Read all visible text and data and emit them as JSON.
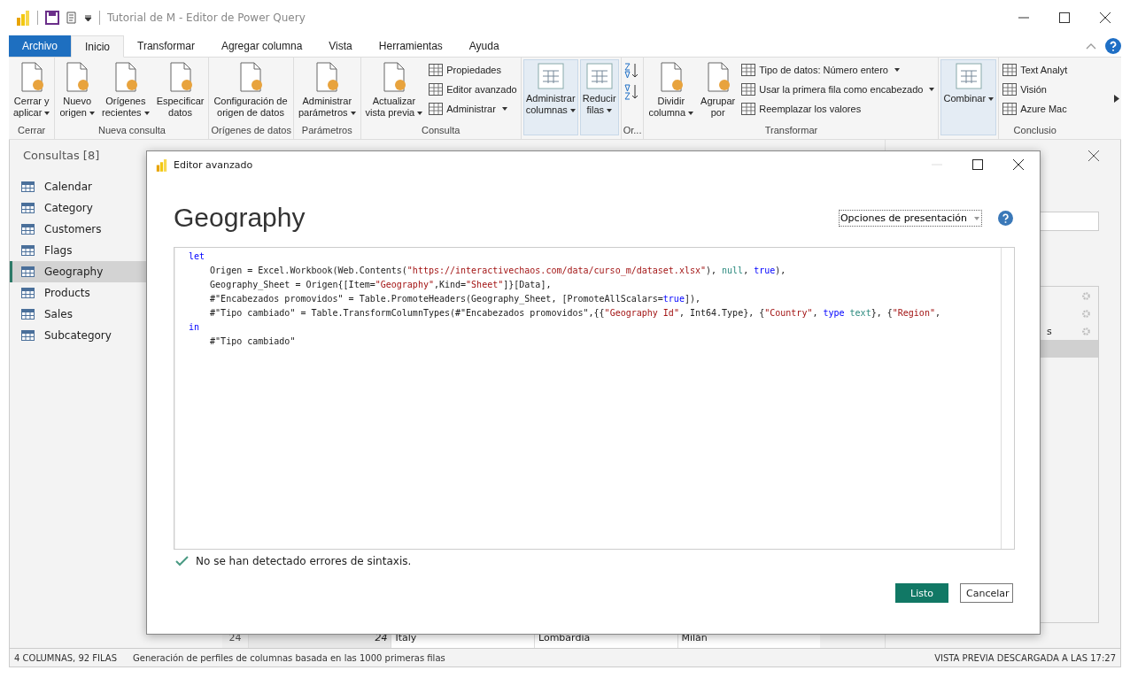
{
  "window": {
    "title": "Tutorial de M - Editor de Power Query"
  },
  "tabs": [
    {
      "label": "Archivo",
      "kind": "file",
      "selected": false
    },
    {
      "label": "Inicio",
      "kind": "tab",
      "selected": true
    },
    {
      "label": "Transformar",
      "kind": "tab",
      "selected": false
    },
    {
      "label": "Agregar columna",
      "kind": "tab",
      "selected": false
    },
    {
      "label": "Vista",
      "kind": "tab",
      "selected": false
    },
    {
      "label": "Herramientas",
      "kind": "tab",
      "selected": false
    },
    {
      "label": "Ayuda",
      "kind": "tab",
      "selected": false
    }
  ],
  "ribbon": [
    {
      "label": "Cerrar",
      "items": [
        {
          "kind": "large",
          "label": "Cerrar y\naplicar",
          "dropdown": true
        }
      ]
    },
    {
      "label": "Nueva consulta",
      "items": [
        {
          "kind": "large",
          "label": "Nuevo\norigen",
          "dropdown": true
        },
        {
          "kind": "large",
          "label": "Orígenes\nrecientes",
          "dropdown": true
        },
        {
          "kind": "large",
          "label": "Especificar\ndatos",
          "dropdown": false
        }
      ]
    },
    {
      "label": "Orígenes de datos",
      "items": [
        {
          "kind": "large",
          "label": "Configuración de\norigen de datos",
          "dropdown": false
        }
      ]
    },
    {
      "label": "Parámetros",
      "items": [
        {
          "kind": "large",
          "label": "Administrar\nparámetros",
          "dropdown": true
        }
      ]
    },
    {
      "label": "Consulta",
      "items": [
        {
          "kind": "large",
          "label": "Actualizar\nvista previa",
          "dropdown": true
        },
        {
          "kind": "stack",
          "entries": [
            {
              "label": "Propiedades",
              "dropdown": false
            },
            {
              "label": "Editor avanzado",
              "dropdown": false
            },
            {
              "label": "Administrar",
              "dropdown": true
            }
          ]
        }
      ]
    },
    {
      "items": [
        {
          "kind": "collapsed",
          "label": "Administrar\ncolumnas",
          "dropdown": true
        },
        {
          "kind": "collapsed",
          "label": "Reducir\nfilas",
          "dropdown": true
        }
      ]
    },
    {
      "label": "Or...",
      "items": [
        {
          "kind": "sort"
        }
      ]
    },
    {
      "label": "Transformar",
      "items": [
        {
          "kind": "large",
          "label": "Dividir\ncolumna",
          "dropdown": true
        },
        {
          "kind": "large",
          "label": "Agrupar\npor",
          "dropdown": false
        },
        {
          "kind": "stack",
          "entries": [
            {
              "label": "Tipo de datos: Número entero",
              "dropdown": true
            },
            {
              "label": "Usar la primera fila como encabezado",
              "dropdown": true
            },
            {
              "label": "Reemplazar los valores",
              "dropdown": false
            }
          ]
        }
      ]
    },
    {
      "items": [
        {
          "kind": "collapsed",
          "label": "Combinar",
          "dropdown": true
        }
      ]
    },
    {
      "label": "Conclusio",
      "items": [
        {
          "kind": "stack",
          "entries": [
            {
              "label": "Text Analyt",
              "dropdown": false
            },
            {
              "label": "Visión",
              "dropdown": false
            },
            {
              "label": "Azure Mac",
              "dropdown": false
            }
          ]
        }
      ]
    }
  ],
  "queries": {
    "title": "Consultas [8]",
    "items": [
      {
        "label": "Calendar",
        "selected": false
      },
      {
        "label": "Category",
        "selected": false
      },
      {
        "label": "Customers",
        "selected": false
      },
      {
        "label": "Flags",
        "selected": false
      },
      {
        "label": "Geography",
        "selected": true
      },
      {
        "label": "Products",
        "selected": false
      },
      {
        "label": "Sales",
        "selected": false
      },
      {
        "label": "Subcategory",
        "selected": false
      }
    ]
  },
  "table_row": {
    "row_number": "24",
    "cells": [
      "24",
      "Italy",
      "Lombardía",
      "Milán"
    ]
  },
  "steps": [
    {
      "selected": false
    },
    {
      "selected": false
    },
    {
      "label": "s",
      "selected": false
    },
    {
      "selected": true
    }
  ],
  "dialog": {
    "title": "Editor avanzado",
    "heading": "Geography",
    "options": "Opciones de presentación",
    "code": [
      [
        {
          "text": "let",
          "kind": "keyword"
        }
      ],
      [
        {
          "text": "    Origen = Excel.Workbook(Web.Contents(",
          "kind": "plain"
        },
        {
          "text": "\"https://interactivechaos.com/data/curso_m/dataset.xlsx\"",
          "kind": "string"
        },
        {
          "text": "), ",
          "kind": "plain"
        },
        {
          "text": "null",
          "kind": "literal"
        },
        {
          "text": ", ",
          "kind": "plain"
        },
        {
          "text": "true",
          "kind": "keyword"
        },
        {
          "text": "),",
          "kind": "plain"
        }
      ],
      [
        {
          "text": "    Geography_Sheet = Origen{[Item=",
          "kind": "plain"
        },
        {
          "text": "\"Geography\"",
          "kind": "string"
        },
        {
          "text": ",Kind=",
          "kind": "plain"
        },
        {
          "text": "\"Sheet\"",
          "kind": "string"
        },
        {
          "text": "]}[Data],",
          "kind": "plain"
        }
      ],
      [
        {
          "text": "    #\"Encabezados promovidos\" = Table.PromoteHeaders(Geography_Sheet, [PromoteAllScalars=",
          "kind": "plain"
        },
        {
          "text": "true",
          "kind": "keyword"
        },
        {
          "text": "]),",
          "kind": "plain"
        }
      ],
      [
        {
          "text": "    #\"Tipo cambiado\" = Table.TransformColumnTypes(#\"Encabezados promovidos\",{{",
          "kind": "plain"
        },
        {
          "text": "\"Geography Id\"",
          "kind": "string"
        },
        {
          "text": ", Int64.Type}, {",
          "kind": "plain"
        },
        {
          "text": "\"Country\"",
          "kind": "string"
        },
        {
          "text": ", ",
          "kind": "plain"
        },
        {
          "text": "type",
          "kind": "keyword"
        },
        {
          "text": " text",
          "kind": "literal"
        },
        {
          "text": "}, {",
          "kind": "plain"
        },
        {
          "text": "\"Region\"",
          "kind": "string"
        },
        {
          "text": ",",
          "kind": "plain"
        }
      ],
      [
        {
          "text": "in",
          "kind": "keyword"
        }
      ],
      [
        {
          "text": "    #\"Tipo cambiado\"",
          "kind": "plain"
        }
      ]
    ],
    "status": "No se han detectado errores de sintaxis.",
    "buttons": [
      {
        "label": "Listo",
        "kind": "primary"
      },
      {
        "label": "Cancelar",
        "kind": "secondary"
      }
    ]
  },
  "status_bar": {
    "left": "4 COLUMNAS, 92 FILAS",
    "message": "Generación de perfiles de columnas basada en las 1000 primeras filas",
    "right": "VISTA PREVIA DESCARGADA A LAS 17:27"
  }
}
